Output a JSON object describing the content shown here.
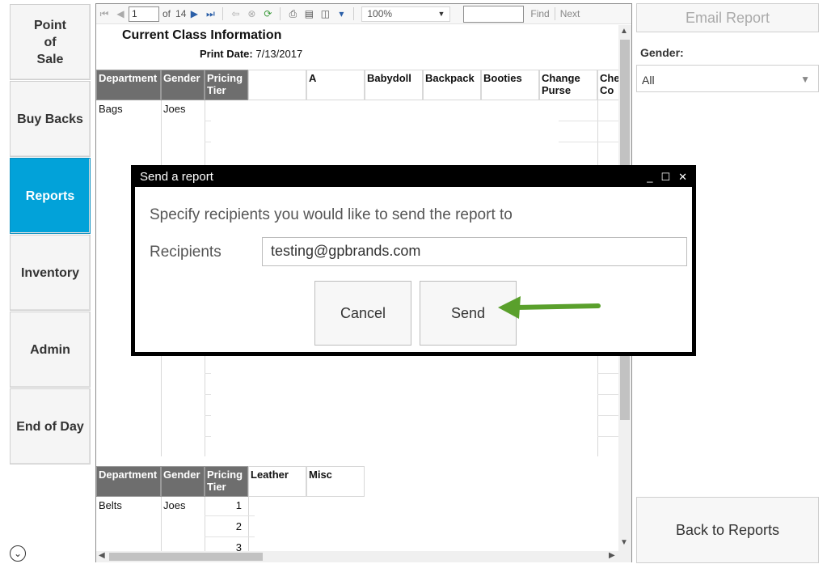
{
  "nav": {
    "items": [
      {
        "label": "Point\nof\nSale"
      },
      {
        "label": "Buy Backs"
      },
      {
        "label": "Reports",
        "active": true
      },
      {
        "label": "Inventory"
      },
      {
        "label": "Admin"
      },
      {
        "label": "End of Day"
      }
    ]
  },
  "toolbar": {
    "page_value": "1",
    "page_of": "of",
    "page_total": "14",
    "zoom": "100%",
    "find_label": "Find",
    "next_label": "Next"
  },
  "report": {
    "title": "Current Class Information",
    "print_date_label": "Print Date:",
    "print_date": "7/13/2017",
    "table1": {
      "headers": [
        "Department",
        "Gender",
        "Pricing Tier",
        "",
        "A",
        "Babydoll",
        "Backpack",
        "Booties",
        "Change Purse",
        "Check Co"
      ],
      "rows": [
        {
          "department": "Bags",
          "gender": "Joes"
        }
      ]
    },
    "table2": {
      "headers": [
        "Department",
        "Gender",
        "Pricing Tier",
        "Leather",
        "Misc"
      ],
      "rows": [
        {
          "department": "Belts",
          "gender": "Joes"
        }
      ],
      "tiers": [
        "1",
        "2",
        "3"
      ]
    }
  },
  "right_panel": {
    "email_button": "Email Report",
    "gender_label": "Gender:",
    "gender_value": "All",
    "back_button": "Back to Reports"
  },
  "modal": {
    "title": "Send a report",
    "prompt": "Specify recipients you would like to send the report to",
    "recipients_label": "Recipients",
    "recipients_value": "testing@gpbrands.com",
    "cancel_label": "Cancel",
    "send_label": "Send"
  },
  "colors": {
    "accent": "#02a2d9",
    "header_dark": "#6e6e6e",
    "arrow": "#5aa02c"
  }
}
